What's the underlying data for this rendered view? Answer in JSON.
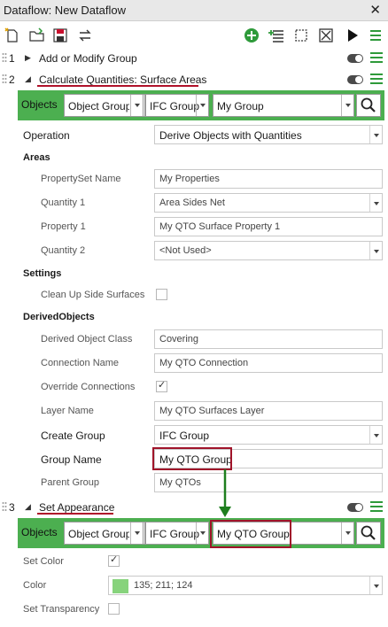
{
  "window": {
    "title": "Dataflow: New Dataflow"
  },
  "toolbar": {
    "icons": [
      "new-icon",
      "open-icon",
      "save-icon",
      "swap-icon",
      "add-step-icon",
      "insert-step-icon",
      "select-icon",
      "clear-icon",
      "run-icon",
      "menu-icon"
    ],
    "accent": "#2e9a3a"
  },
  "steps": [
    {
      "number": "1",
      "label": "Add or Modify Group"
    },
    {
      "number": "2",
      "label": "Calculate Quantities: Surface Areas"
    },
    {
      "number": "3",
      "label": "Set Appearance"
    }
  ],
  "objects_bar_1": {
    "label": "Objects",
    "object_group": "Object Group",
    "type": "IFC Group",
    "group": "My Group"
  },
  "operation": {
    "label": "Operation",
    "value": "Derive Objects with Quantities"
  },
  "areas": {
    "heading": "Areas",
    "propertyset_name": {
      "label": "PropertySet Name",
      "value": "My Properties"
    },
    "quantity1": {
      "label": "Quantity 1",
      "value": "Area Sides Net"
    },
    "property1": {
      "label": "Property 1",
      "value": "My QTO Surface Property 1"
    },
    "quantity2": {
      "label": "Quantity 2",
      "value": "<Not Used>"
    }
  },
  "settings": {
    "heading": "Settings",
    "clean_up": {
      "label": "Clean Up Side Surfaces",
      "checked": false
    }
  },
  "derived": {
    "heading": "DerivedObjects",
    "class": {
      "label": "Derived Object Class",
      "value": "Covering"
    },
    "connection_name": {
      "label": "Connection Name",
      "value": "My QTO Connection"
    },
    "override": {
      "label": "Override Connections",
      "checked": true,
      "mark": "✓"
    },
    "layer_name": {
      "label": "Layer Name",
      "value": "My QTO Surfaces Layer"
    },
    "create_group": {
      "label": "Create Group",
      "value": "IFC Group"
    },
    "group_name": {
      "label": "Group Name",
      "value": "My QTO Group"
    },
    "parent_group": {
      "label": "Parent Group",
      "value": "My QTOs"
    }
  },
  "objects_bar_3": {
    "label": "Objects",
    "object_group": "Object Group",
    "type": "IFC Group",
    "group": "My QTO Group"
  },
  "appearance": {
    "set_color": {
      "label": "Set Color",
      "checked": true,
      "mark": "✓"
    },
    "color": {
      "label": "Color",
      "value": "135; 211; 124",
      "swatch": "#87d37c"
    },
    "set_transparency": {
      "label": "Set Transparency",
      "checked": false
    }
  }
}
